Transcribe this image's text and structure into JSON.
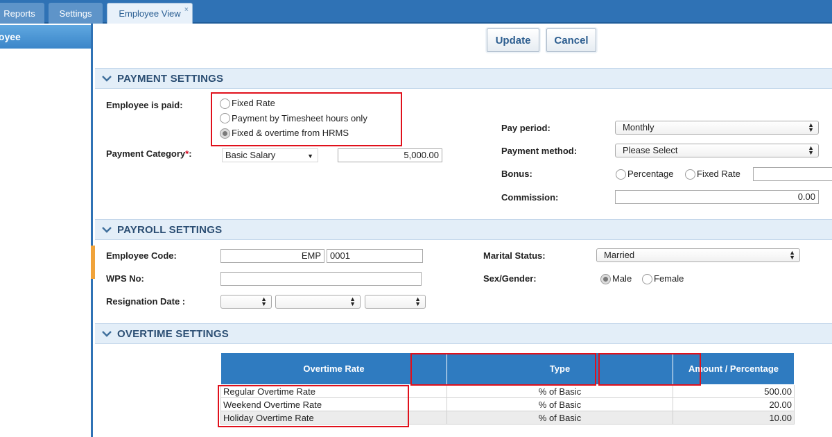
{
  "tabs": [
    {
      "label": "Reports"
    },
    {
      "label": "Settings"
    },
    {
      "label": "Employee View",
      "close": "×"
    }
  ],
  "sidebar": {
    "active_item": "loyee"
  },
  "actions": {
    "update": "Update",
    "cancel": "Cancel"
  },
  "payment": {
    "title": "PAYMENT SETTINGS",
    "paid_label": "Employee is paid:",
    "paid_options": [
      "Fixed Rate",
      "Payment by Timesheet hours only",
      "Fixed & overtime from HRMS"
    ],
    "paid_selected": 2,
    "category_label": "Payment Category",
    "category_required": "*",
    "category_colon": ":",
    "category_value": "Basic Salary",
    "category_amount": "5,000.00",
    "pay_period_label": "Pay period:",
    "pay_period_value": "Monthly",
    "method_label": "Payment method:",
    "method_value": "Please Select",
    "bonus_label": "Bonus:",
    "bonus_options": [
      "Percentage",
      "Fixed Rate"
    ],
    "bonus_value": "",
    "commission_label": "Commission:",
    "commission_value": "0.00"
  },
  "payroll": {
    "title": "PAYROLL SETTINGS",
    "code_label": "Employee Code:",
    "code_prefix": "EMP",
    "code_number": "0001",
    "wps_label": "WPS No:",
    "wps_value": "",
    "resignation_label": "Resignation Date :",
    "marital_label": "Marital Status:",
    "marital_value": "Married",
    "gender_label": "Sex/Gender:",
    "gender_options": [
      "Male",
      "Female"
    ],
    "gender_selected": 0
  },
  "overtime": {
    "title": "OVERTIME SETTINGS",
    "columns": [
      "Overtime Rate",
      "Type",
      "Amount / Percentage"
    ],
    "rows": [
      {
        "rate": "Regular Overtime Rate",
        "type": "% of Basic",
        "amount": "500.00"
      },
      {
        "rate": "Weekend Overtime Rate",
        "type": "% of Basic",
        "amount": "20.00"
      },
      {
        "rate": "Holiday Overtime Rate",
        "type": "% of Basic",
        "amount": "10.00"
      }
    ]
  },
  "colors": {
    "accent": "#2f72b5",
    "section_bg": "#e3eef8",
    "highlight": "#e0101b",
    "sidebar_handle": "#f0a33a"
  }
}
